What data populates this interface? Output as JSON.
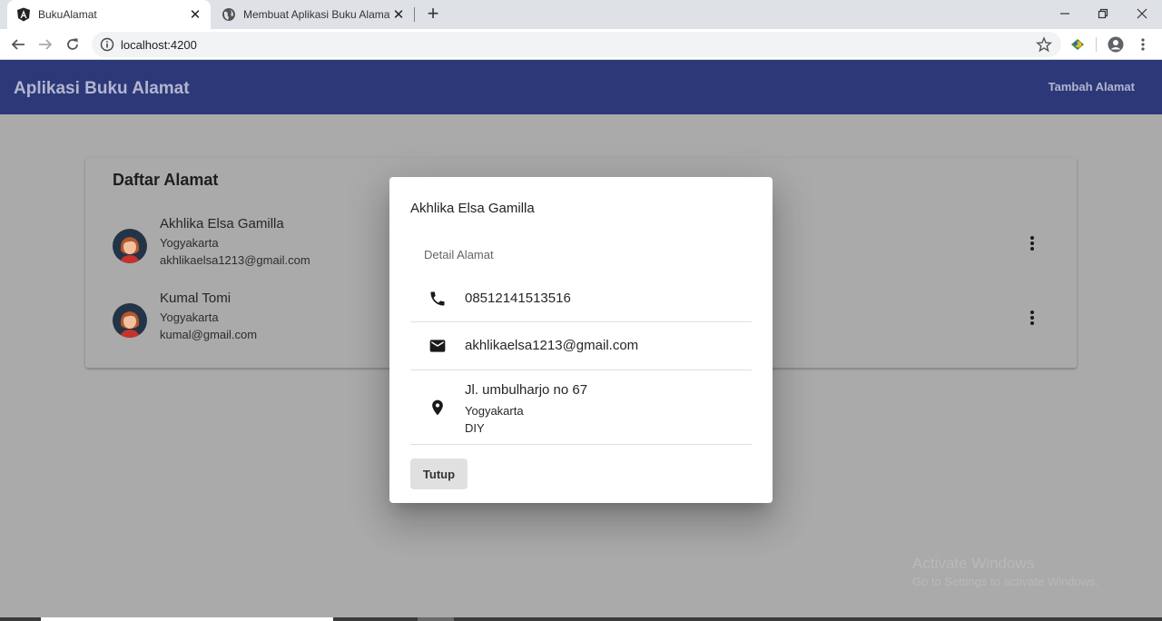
{
  "browser": {
    "tabs": [
      {
        "title": "BukuAlamat",
        "active": true
      },
      {
        "title": "Membuat Aplikasi Buku Alamat M",
        "active": false
      }
    ],
    "url": "localhost:4200"
  },
  "app": {
    "title": "Aplikasi Buku Alamat",
    "action": "Tambah Alamat"
  },
  "list": {
    "title": "Daftar Alamat",
    "contacts": [
      {
        "name": "Akhlika Elsa Gamilla",
        "city": "Yogyakarta",
        "email": "akhlikaelsa1213@gmail.com"
      },
      {
        "name": "Kumal Tomi",
        "city": "Yogyakarta",
        "email": "kumal@gmail.com"
      }
    ]
  },
  "dialog": {
    "title": "Akhlika Elsa Gamilla",
    "subheader": "Detail Alamat",
    "phone": "08512141513516",
    "email": "akhlikaelsa1213@gmail.com",
    "address": {
      "street": "Jl. umbulharjo no 67",
      "city": "Yogyakarta",
      "province": "DIY"
    },
    "close_label": "Tutup"
  },
  "watermark": {
    "line1": "Activate Windows",
    "line2": "Go to Settings to activate Windows."
  },
  "icons": {
    "phone": "phone-icon",
    "email": "mail-icon",
    "address": "location-pin-icon",
    "more": "more-vert-icon"
  },
  "colors": {
    "appbar": "#2d3878",
    "overlay_background": "#aaaaaa",
    "dialog": "#ffffff"
  }
}
